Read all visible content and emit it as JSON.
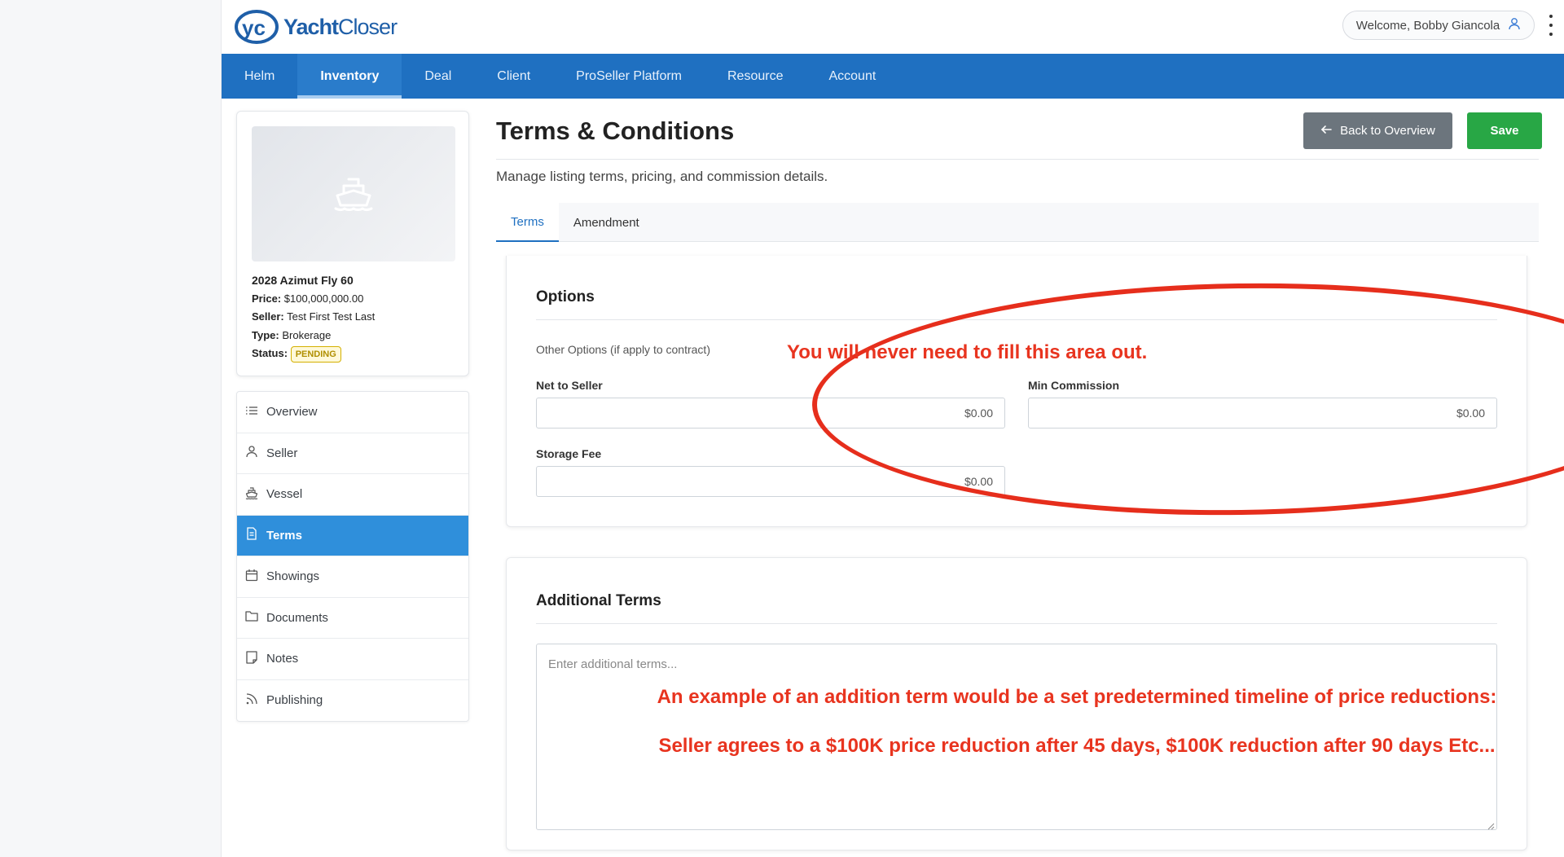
{
  "header": {
    "logo_initials": "yc",
    "logo_word_bold": "Yacht",
    "logo_word_light": "Closer",
    "welcome": "Welcome, Bobby Giancola"
  },
  "nav": {
    "items": [
      {
        "label": "Helm"
      },
      {
        "label": "Inventory"
      },
      {
        "label": "Deal"
      },
      {
        "label": "Client"
      },
      {
        "label": "ProSeller Platform"
      },
      {
        "label": "Resource"
      },
      {
        "label": "Account"
      }
    ],
    "active": "Inventory"
  },
  "vessel": {
    "title": "2028 Azimut Fly 60",
    "price_label": "Price:",
    "price": "$100,000,000.00",
    "seller_label": "Seller:",
    "seller": "Test First Test Last",
    "type_label": "Type:",
    "type": "Brokerage",
    "status_label": "Status:",
    "status": "PENDING",
    "status_color": "#d4b000"
  },
  "sidebar": {
    "items": [
      {
        "label": "Overview",
        "icon": "list-icon"
      },
      {
        "label": "Seller",
        "icon": "user-icon"
      },
      {
        "label": "Vessel",
        "icon": "boat-icon"
      },
      {
        "label": "Terms",
        "icon": "document-icon"
      },
      {
        "label": "Showings",
        "icon": "calendar-icon"
      },
      {
        "label": "Documents",
        "icon": "folder-icon"
      },
      {
        "label": "Notes",
        "icon": "note-icon"
      },
      {
        "label": "Publishing",
        "icon": "rss-icon"
      }
    ],
    "active": "Terms"
  },
  "page": {
    "title": "Terms & Conditions",
    "subtitle": "Manage listing terms, pricing, and commission details.",
    "back_button": "Back to Overview",
    "save_button": "Save"
  },
  "tabs": [
    {
      "label": "Terms"
    },
    {
      "label": "Amendment"
    }
  ],
  "options": {
    "heading": "Options",
    "other_options": "Other Options (if apply to contract)",
    "net_to_seller_label": "Net to Seller",
    "net_to_seller_value": "$0.00",
    "min_commission_label": "Min Commission",
    "min_commission_value": "$0.00",
    "storage_fee_label": "Storage Fee",
    "storage_fee_value": "$0.00"
  },
  "additional_terms": {
    "heading": "Additional Terms",
    "placeholder": "Enter additional terms..."
  },
  "annotations": {
    "options_note": "You will never need to fill this area out.",
    "terms_note_1": "An example of an addition term would be a set predetermined timeline of price reductions:",
    "terms_note_2": "Seller agrees to a $100K price reduction after 45 days, $100K reduction after 90 days Etc...",
    "color": "#e8341f"
  },
  "colors": {
    "nav": "#1f70c1",
    "active_sidebar": "#2f8fdb",
    "save": "#28a745",
    "back": "#6c757d"
  }
}
